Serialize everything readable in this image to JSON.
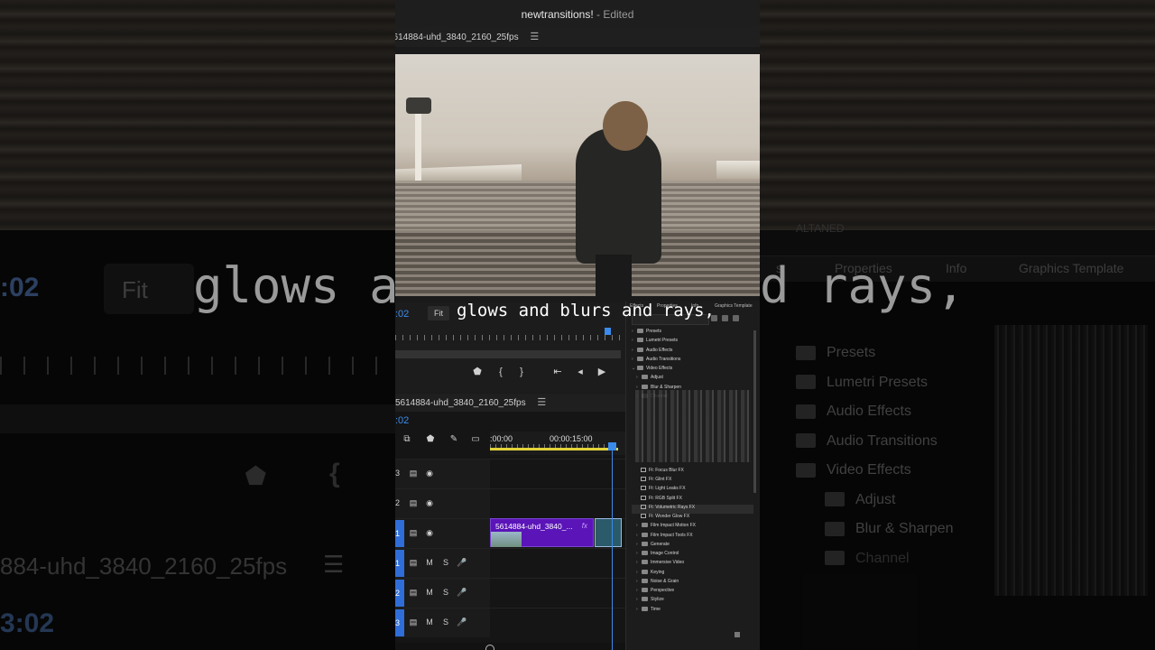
{
  "window": {
    "title": "newtransitions!",
    "status": " - Edited"
  },
  "program_monitor": {
    "sequence_name": "5614884-uhd_3840_2160_25fps",
    "sequence_name_shown": "5614884-uhd_3840_2160_25fps",
    "timecode": ":02",
    "zoom": "Fit"
  },
  "caption": {
    "text": "glows and blurs and rays,"
  },
  "timeline": {
    "sequence_name": "5614884-uhd_3840_2160_25fps",
    "timecode": ":02",
    "ruler_labels": [
      ":00:00",
      "00:00:15:00"
    ],
    "tracks": [
      {
        "id": "3",
        "type": "video"
      },
      {
        "id": "2",
        "type": "video"
      },
      {
        "id": "1",
        "type": "video"
      },
      {
        "id": "1",
        "type": "audio"
      },
      {
        "id": "2",
        "type": "audio"
      },
      {
        "id": "3",
        "type": "audio"
      }
    ],
    "clip": {
      "name": "5614884-uhd_3840_...",
      "badge": "fx",
      "color": "#5a14b8"
    }
  },
  "effects_panel": {
    "tabs": [
      "Effects",
      "Properties",
      "Info",
      "Graphics Template"
    ],
    "items": [
      {
        "label": "Presets",
        "level": 0,
        "kind": "folder"
      },
      {
        "label": "Lumetri Presets",
        "level": 0,
        "kind": "folder"
      },
      {
        "label": "Audio Effects",
        "level": 0,
        "kind": "folder"
      },
      {
        "label": "Audio Transitions",
        "level": 0,
        "kind": "folder"
      },
      {
        "label": "Video Effects",
        "level": 0,
        "kind": "folder",
        "open": true
      },
      {
        "label": "Adjust",
        "level": 1,
        "kind": "folder"
      },
      {
        "label": "Blur & Sharpen",
        "level": 1,
        "kind": "folder"
      },
      {
        "label": "Channel",
        "level": 1,
        "kind": "folder"
      },
      {
        "label": "",
        "level": 1,
        "kind": "blank"
      },
      {
        "label": "",
        "level": 1,
        "kind": "blank"
      },
      {
        "label": "",
        "level": 1,
        "kind": "blank"
      },
      {
        "label": "",
        "level": 1,
        "kind": "blank"
      },
      {
        "label": "",
        "level": 1,
        "kind": "blank"
      },
      {
        "label": "",
        "level": 1,
        "kind": "blank"
      },
      {
        "label": "",
        "level": 1,
        "kind": "blank"
      },
      {
        "label": "Ft: Focus Blur FX",
        "level": 2,
        "kind": "preset"
      },
      {
        "label": "Ft: Glint FX",
        "level": 2,
        "kind": "preset"
      },
      {
        "label": "Ft: Light Leaks FX",
        "level": 2,
        "kind": "preset"
      },
      {
        "label": "Ft: RGB Split FX",
        "level": 2,
        "kind": "preset"
      },
      {
        "label": "Ft: Volumetric Rays FX",
        "level": 2,
        "kind": "preset",
        "selected": true
      },
      {
        "label": "Ft: Wonder Glow FX",
        "level": 2,
        "kind": "preset"
      },
      {
        "label": "Film Impact Motion FX",
        "level": 1,
        "kind": "folder"
      },
      {
        "label": "Film Impact Tools FX",
        "level": 1,
        "kind": "folder"
      },
      {
        "label": "Generate",
        "level": 1,
        "kind": "folder"
      },
      {
        "label": "Image Control",
        "level": 1,
        "kind": "folder"
      },
      {
        "label": "Immersive Video",
        "level": 1,
        "kind": "folder"
      },
      {
        "label": "Keying",
        "level": 1,
        "kind": "folder"
      },
      {
        "label": "Noise & Grain",
        "level": 1,
        "kind": "folder"
      },
      {
        "label": "Perspective",
        "level": 1,
        "kind": "folder"
      },
      {
        "label": "Stylize",
        "level": 1,
        "kind": "folder"
      },
      {
        "label": "Time",
        "level": 1,
        "kind": "folder"
      }
    ]
  },
  "backdrop": {
    "left_timecode": ":02",
    "left_fit": "Fit",
    "left_caption": "glows a",
    "left_sequence": "884-uhd_3840_2160_25fps",
    "left_timecode_2": "3:02",
    "left_channel_text": "Blur & Sharpen",
    "right_caption": "d rays,",
    "right_tabs": [
      "s",
      "Properties",
      "Info",
      "Graphics Template"
    ],
    "right_items": [
      "Presets",
      "Lumetri Presets",
      "Audio Effects",
      "Audio Transitions",
      "Video Effects",
      "Adjust",
      "Blur & Sharpen",
      "Channel"
    ],
    "right_top_text": "ALTANED"
  }
}
